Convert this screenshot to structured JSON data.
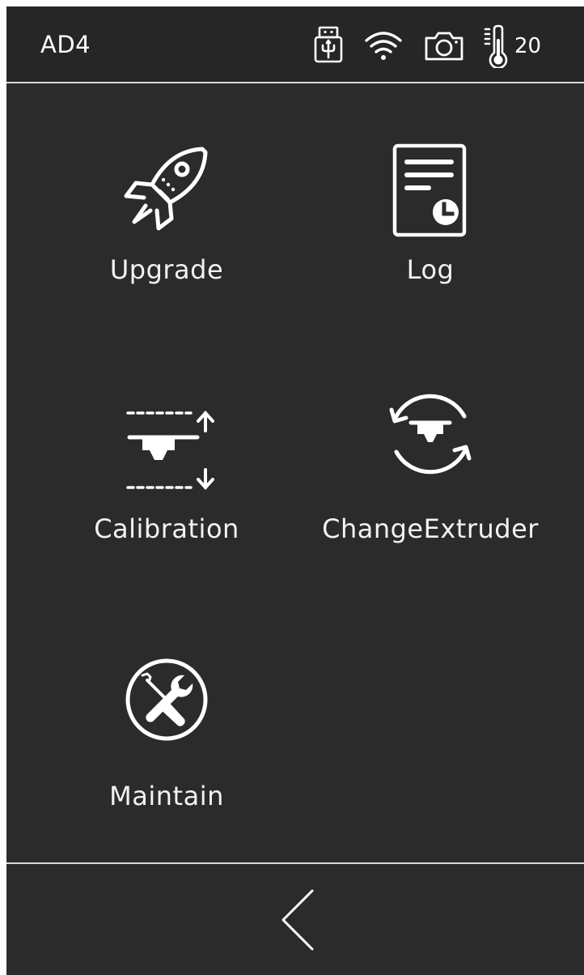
{
  "status_bar": {
    "device_name": "AD4",
    "icons": [
      "usb-drive-icon",
      "wifi-icon",
      "camera-icon",
      "thermometer-icon"
    ],
    "temperature": "20"
  },
  "menu": {
    "items": [
      {
        "label": "Upgrade",
        "icon": "rocket-icon"
      },
      {
        "label": "Log",
        "icon": "log-document-icon"
      },
      {
        "label": "Calibration",
        "icon": "calibration-icon"
      },
      {
        "label": "ChangeExtruder",
        "icon": "change-extruder-icon"
      },
      {
        "label": "Maintain",
        "icon": "maintain-tools-icon"
      }
    ]
  },
  "navigation": {
    "back_icon": "chevron-left-icon"
  },
  "colors": {
    "background": "#2b2b2b",
    "status_bar": "#262626",
    "foreground": "#ffffff",
    "divider": "#d8d8d8"
  }
}
